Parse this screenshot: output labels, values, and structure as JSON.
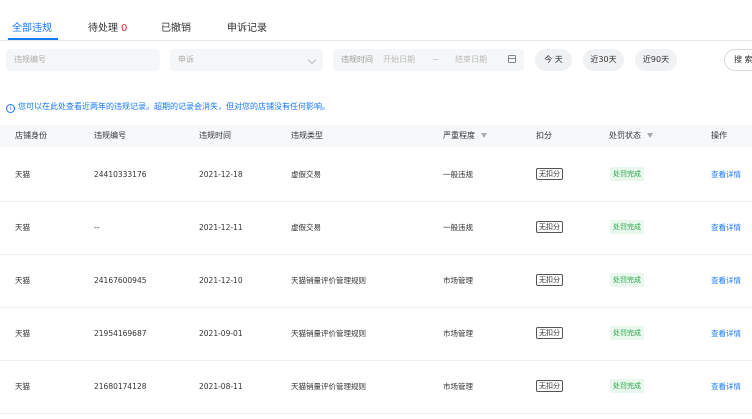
{
  "tabs": [
    {
      "label": "全部违规",
      "active": true
    },
    {
      "label": "待处理",
      "count": "0"
    },
    {
      "label": "已撤销"
    },
    {
      "label": "申诉记录"
    }
  ],
  "filters": {
    "violation_no_placeholder": "违规编号",
    "appeal_select": "申诉",
    "time_label": "违规时间",
    "start_date_placeholder": "开始日期",
    "date_separator": "~",
    "end_date_placeholder": "结束日期",
    "quick_ranges": [
      "今 天",
      "近30天",
      "近90天"
    ],
    "search_label": "搜 索"
  },
  "notice": "您可以在此处查看近两年的违规记录。超期的记录会消失，但对您的店铺没有任何影响。",
  "table": {
    "columns": [
      "店铺身份",
      "违规编号",
      "违规时间",
      "违规类型",
      "严重程度",
      "扣分",
      "处罚状态",
      "操作"
    ],
    "rows": [
      {
        "identity": "天猫",
        "violation_no": "24410333176",
        "time": "2021-12-18",
        "type": "虚假交易",
        "severity": "一般违规",
        "deduct": "无扣分",
        "status": "处罚完成",
        "action": "查看详情"
      },
      {
        "identity": "天猫",
        "violation_no": "--",
        "time": "2021-12-11",
        "type": "虚假交易",
        "severity": "一般违规",
        "deduct": "无扣分",
        "status": "处罚完成",
        "action": "查看详情"
      },
      {
        "identity": "天猫",
        "violation_no": "24167600945",
        "time": "2021-12-10",
        "type": "天猫销量评价管理规则",
        "severity": "市场管理",
        "deduct": "无扣分",
        "status": "处罚完成",
        "action": "查看详情"
      },
      {
        "identity": "天猫",
        "violation_no": "21954169687",
        "time": "2021-09-01",
        "type": "天猫销量评价管理规则",
        "severity": "市场管理",
        "deduct": "无扣分",
        "status": "处罚完成",
        "action": "查看详情"
      },
      {
        "identity": "天猫",
        "violation_no": "21680174128",
        "time": "2021-08-11",
        "type": "天猫销量评价管理规则",
        "severity": "市场管理",
        "deduct": "无扣分",
        "status": "处罚完成",
        "action": "查看详情"
      }
    ]
  },
  "colors": {
    "accent": "#1677ff",
    "status_bg": "#e8f8ec",
    "status_text": "#28a745",
    "pending_count": "#f5222d"
  }
}
